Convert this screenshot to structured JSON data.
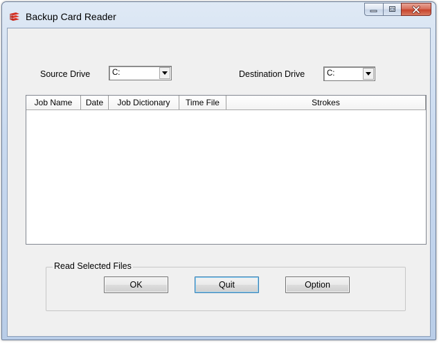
{
  "window": {
    "title": "Backup Card Reader",
    "app_icon": "red-stacked-cards-icon",
    "caption_buttons": [
      "minimize-icon",
      "maximize-icon",
      "close-icon"
    ]
  },
  "source": {
    "label": "Source Drive",
    "value": "C:"
  },
  "destination": {
    "label": "Destination Drive",
    "value": "C:"
  },
  "table": {
    "columns": [
      "Job Name",
      "Date",
      "Job Dictionary",
      "Time File",
      "Strokes"
    ],
    "rows": []
  },
  "read_group": {
    "title": "Read Selected Files",
    "ok_label": "OK",
    "quit_label": "Quit",
    "option_label": "Option"
  },
  "colors": {
    "app_icon_red": "#d42b1f",
    "close_button": "#c7432c",
    "default_button_border": "#3c7fb1"
  }
}
